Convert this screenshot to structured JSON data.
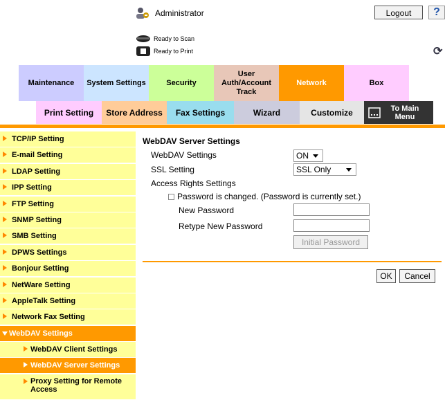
{
  "header": {
    "user": "Administrator",
    "logout_label": "Logout",
    "help_label": "?",
    "status_scan": "Ready to Scan",
    "status_print": "Ready to Print"
  },
  "tabs_main": [
    {
      "label": "Maintenance",
      "color": "#ccccff"
    },
    {
      "label": "System Settings",
      "color": "#cce5ff"
    },
    {
      "label": "Security",
      "color": "#ccff99"
    },
    {
      "label": "User Auth/Account Track",
      "color": "#e8c7b8"
    },
    {
      "label": "Network",
      "color": "#ff9900"
    },
    {
      "label": "Box",
      "color": "#ffccff"
    }
  ],
  "tabs_sub": [
    {
      "label": "Print Setting",
      "color": "#ffccff"
    },
    {
      "label": "Store Address",
      "color": "#ffcc99"
    },
    {
      "label": "Fax Settings",
      "color": "#99ddee"
    },
    {
      "label": "Wizard",
      "color": "#ccccdd"
    },
    {
      "label": "Customize",
      "color": "#e5e5e5"
    },
    {
      "label": "To Main Menu",
      "color": "#333333"
    }
  ],
  "sidebar": {
    "items": [
      {
        "label": "TCP/IP Setting"
      },
      {
        "label": "E-mail Setting"
      },
      {
        "label": "LDAP Setting"
      },
      {
        "label": "IPP Setting"
      },
      {
        "label": "FTP Setting"
      },
      {
        "label": "SNMP Setting"
      },
      {
        "label": "SMB Setting"
      },
      {
        "label": "DPWS Settings"
      },
      {
        "label": "Bonjour Setting"
      },
      {
        "label": "NetWare Setting"
      },
      {
        "label": "AppleTalk Setting"
      },
      {
        "label": "Network Fax Setting"
      },
      {
        "label": "WebDAV Settings"
      },
      {
        "label": "WebDAV Client Settings"
      },
      {
        "label": "WebDAV Server Settings"
      },
      {
        "label": "Proxy Setting for Remote Access"
      }
    ]
  },
  "content": {
    "title": "WebDAV Server Settings",
    "webdav_label": "WebDAV Settings",
    "webdav_value": "ON",
    "ssl_label": "SSL Setting",
    "ssl_value": "SSL Only",
    "access_label": "Access Rights Settings",
    "password_changed_label": "Password is changed.  (Password is currently set.)",
    "new_password_label": "New Password",
    "retype_password_label": "Retype New Password",
    "initial_password_button": "Initial Password",
    "ok_button": "OK",
    "cancel_button": "Cancel"
  }
}
